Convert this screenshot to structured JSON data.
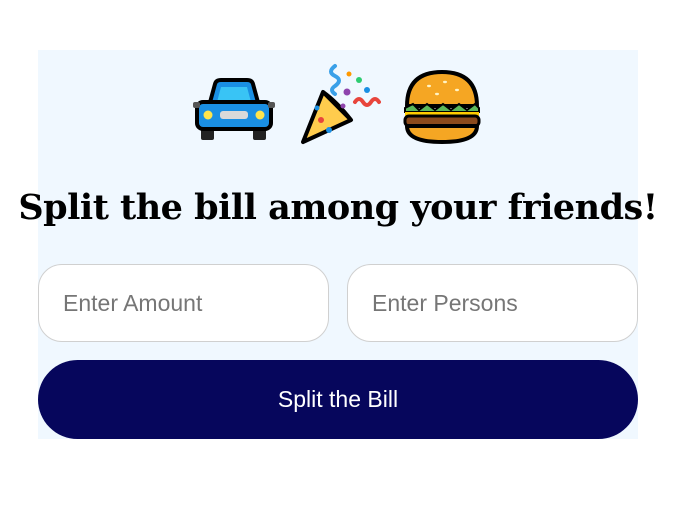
{
  "header": {
    "emojis": [
      "car-icon",
      "party-popper-icon",
      "hamburger-icon"
    ],
    "title": "Split the bill among your friends!"
  },
  "form": {
    "amount_placeholder": "Enter Amount",
    "persons_placeholder": "Enter Persons",
    "amount_value": "",
    "persons_value": "",
    "submit_label": "Split the Bill"
  },
  "colors": {
    "card_background": "#f0f8ff",
    "button_background": "#06065c",
    "button_text": "#ffffff"
  }
}
